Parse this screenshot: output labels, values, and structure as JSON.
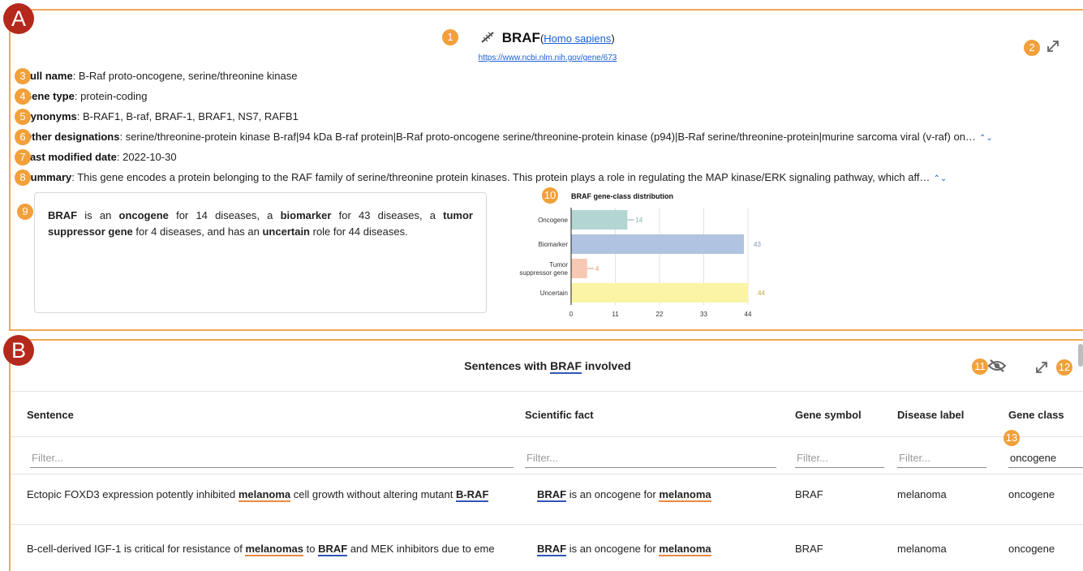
{
  "markers": {
    "sectionA": "A",
    "sectionB": "B",
    "n1": "1",
    "n2": "2",
    "n3": "3",
    "n4": "4",
    "n5": "5",
    "n6": "6",
    "n7": "7",
    "n8": "8",
    "n9": "9",
    "n10": "10",
    "n11": "11",
    "n12": "12",
    "n13": "13"
  },
  "gene": {
    "symbol": "BRAF",
    "paren_open": "(",
    "species": "Homo sapiens",
    "paren_close": ")",
    "link": "https://www.ncbi.nlm.nih.gov/gene/673",
    "info": [
      {
        "label": "Full name",
        "value": ": B-Raf proto-oncogene, serine/threonine kinase"
      },
      {
        "label": "Gene type",
        "value": ": protein-coding"
      },
      {
        "label": "Synonyms",
        "value": ": B-RAF1, B-raf, BRAF-1, BRAF1, NS7, RAFB1"
      },
      {
        "label": "Other designations",
        "value": ": serine/threonine-protein kinase B-raf|94 kDa B-raf protein|B-Raf proto-oncogene serine/threonine-protein kinase (p94)|B-Raf serine/threonine-protein|murine sarcoma viral (v-raf) on…"
      },
      {
        "label": "Last modified date",
        "value": ": 2022-10-30"
      },
      {
        "label": "Summary",
        "value": ": This gene encodes a protein belonging to the RAF family of serine/threonine protein kinases. This protein plays a role in regulating the MAP kinase/ERK signaling pathway, which aff…"
      }
    ],
    "expand_symbol": "⌃⌄"
  },
  "statement": {
    "p1": "BRAF",
    "p2": " is an ",
    "p3": "oncogene",
    "p4": " for 14 diseases, a ",
    "p5": "biomarker",
    "p6": " for 43 diseases, a ",
    "p7": "tumor suppressor gene",
    "p8": " for 4 diseases, and has an ",
    "p9": "uncertain",
    "p10": " role for 44 diseases."
  },
  "chart_data": {
    "type": "bar",
    "orientation": "horizontal",
    "title": "BRAF gene-class distribution",
    "categories": [
      "Oncogene",
      "Biomarker",
      "Tumor suppressor gene",
      "Uncertain"
    ],
    "category_label_lines": [
      [
        "Oncogene"
      ],
      [
        "Biomarker"
      ],
      [
        "Tumor",
        "suppressor gene"
      ],
      [
        "Uncertain"
      ]
    ],
    "values": [
      14,
      43,
      4,
      44
    ],
    "bar_colors": [
      "#b4d6d3",
      "#b0c3e0",
      "#f7c9b4",
      "#fbf4a5"
    ],
    "value_label_colors": [
      "#7fb1ad",
      "#7d93b8",
      "#e39473",
      "#b5ad45"
    ],
    "xticks": [
      0,
      11,
      22,
      33,
      44
    ],
    "xlim": [
      0,
      44
    ],
    "grid": true
  },
  "table": {
    "title_prefix": "Sentences with ",
    "title_gene": "BRAF",
    "title_suffix": " involved",
    "columns": [
      "Sentence",
      "Scientific fact",
      "Gene symbol",
      "Disease label",
      "Gene class"
    ],
    "filter_placeholder": "Filter...",
    "gene_class_filter": "oncogene",
    "rows": [
      {
        "sentence": [
          "Ectopic FOXD3 expression potently inhibited ",
          "melanoma",
          " cell growth without altering mutant ",
          "B-RAF"
        ],
        "fact": [
          "BRAF",
          " is an oncogene for ",
          "melanoma"
        ],
        "gene_symbol": "BRAF",
        "disease_label": "melanoma",
        "gene_class": "oncogene"
      },
      {
        "sentence": [
          "B-cell-derived IGF-1 is critical for resistance of ",
          "melanomas",
          " to ",
          "BRAF",
          " and MEK inhibitors due to eme"
        ],
        "fact": [
          "BRAF",
          " is an oncogene for ",
          "melanoma"
        ],
        "gene_symbol": "BRAF",
        "disease_label": "melanoma",
        "gene_class": "oncogene"
      }
    ]
  },
  "icons": {
    "gene": "dna-icon",
    "expand": "expand-arrows-icon",
    "hide": "eye-off-icon"
  }
}
